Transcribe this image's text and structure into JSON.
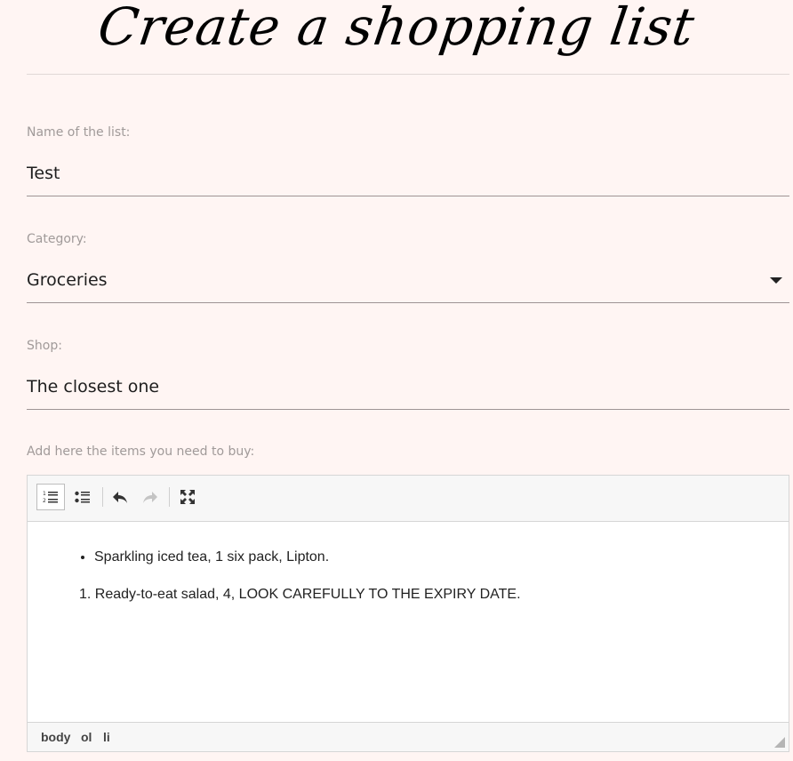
{
  "header": {
    "title": "Create a shopping list"
  },
  "form": {
    "name_label": "Name of the list:",
    "name_value": "Test",
    "category_label": "Category:",
    "category_value": "Groceries",
    "shop_label": "Shop:",
    "shop_value": "The closest one",
    "items_label": "Add here the items you need to buy:"
  },
  "editor": {
    "toolbar": [
      "numbered-list-icon",
      "bulleted-list-icon",
      "undo-icon",
      "redo-icon",
      "fullscreen-icon"
    ],
    "bullet_items": [
      "Sparkling iced tea, 1 six pack, Lipton."
    ],
    "numbered_items": [
      "Ready-to-eat salad, 4, LOOK CAREFULLY TO THE EXPIRY DATE."
    ],
    "path": [
      "body",
      "ol",
      "li"
    ]
  },
  "colors": {
    "background": "#fff5f3",
    "label": "#a09a99",
    "underline": "#9e9494"
  }
}
